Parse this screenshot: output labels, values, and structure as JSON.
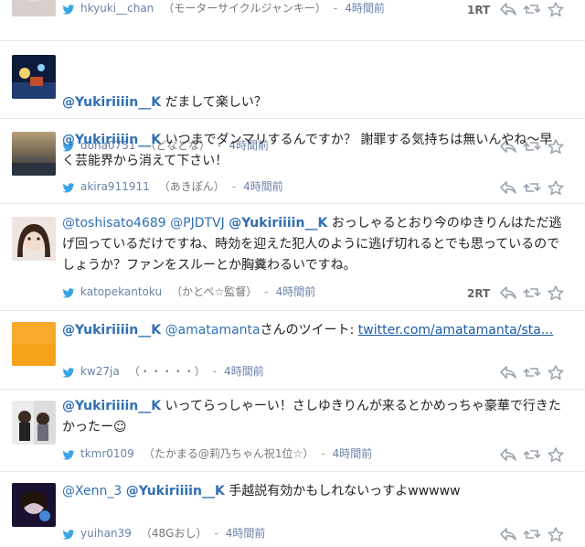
{
  "tweets": [
    {
      "segments": [],
      "user": "hkyuki__chan",
      "name": "（モーターサイクルジャンキー）",
      "time": "4時間前",
      "rt": "1RT"
    },
    {
      "segments": [
        {
          "t": "@Yukiriiiin__K",
          "k": "mention"
        },
        {
          "t": " だまして楽しい？",
          "k": "text"
        }
      ],
      "user": "dona0751",
      "name": "（どなどな）",
      "time": "4時間前",
      "rt": ""
    },
    {
      "segments": [
        {
          "t": "@Yukiriiiin__K",
          "k": "mention"
        },
        {
          "t": " いつまでダンマリするんですか？ 謝罪する気持ちは無いんやね〜早く芸能界から消えて下さい！",
          "k": "text"
        }
      ],
      "user": "akira911911",
      "name": "（あきぽん）",
      "time": "4時間前",
      "rt": ""
    },
    {
      "segments": [
        {
          "t": "@toshisato4689",
          "k": "plain"
        },
        {
          "t": " ",
          "k": "text"
        },
        {
          "t": "@PJDTVJ",
          "k": "plain"
        },
        {
          "t": " ",
          "k": "text"
        },
        {
          "t": "@Yukiriiiin__K",
          "k": "mention"
        },
        {
          "t": " おっしゃるとおり今のゆきりんはただ逃げ回っているだけですね、時効を迎えた犯人のように逃げ切れるとでも思っているのでしょうか？ファンをスルーとか胸糞わるいですね。",
          "k": "text"
        }
      ],
      "user": "katopekantoku",
      "name": "（かとぺ☆監督）",
      "time": "4時間前",
      "rt": "2RT"
    },
    {
      "segments": [
        {
          "t": "@Yukiriiiin__K",
          "k": "mention"
        },
        {
          "t": " ",
          "k": "text"
        },
        {
          "t": "@amatamanta",
          "k": "plain"
        },
        {
          "t": "さんのツイート: ",
          "k": "text"
        },
        {
          "t": "twitter.com/amatamanta/sta...",
          "k": "link"
        }
      ],
      "user": "kw27ja",
      "name": "（・・・・・）",
      "time": "4時間前",
      "rt": ""
    },
    {
      "segments": [
        {
          "t": "@Yukiriiiin__K",
          "k": "mention"
        },
        {
          "t": " いってらっしゃーい！さしゆきりんが来るとかめっちゃ豪華で行きたかったー☺",
          "k": "text"
        }
      ],
      "user": "tkmr0109",
      "name": "（たかまる@莉乃ちゃん祝1位☆）",
      "time": "4時間前",
      "rt": ""
    },
    {
      "segments": [
        {
          "t": "@Xenn_3",
          "k": "plain"
        },
        {
          "t": " ",
          "k": "text"
        },
        {
          "t": "@Yukiriiiin__K",
          "k": "mention"
        },
        {
          "t": " 手越説有効かもしれないっすよwwwww",
          "k": "text"
        }
      ],
      "user": "yuihan39",
      "name": "（48Gおし）",
      "time": "4時間前",
      "rt": ""
    }
  ],
  "sep": "-",
  "icons": {
    "bird": "twitter-bird-icon",
    "reply": "reply-icon",
    "retweet": "retweet-icon",
    "favorite": "star-icon"
  },
  "colors": {
    "mention": "#2f6fb3",
    "meta_link": "#6a82a8",
    "bird": "#3aa3e3",
    "orange_avatar": "#f7a21b"
  }
}
